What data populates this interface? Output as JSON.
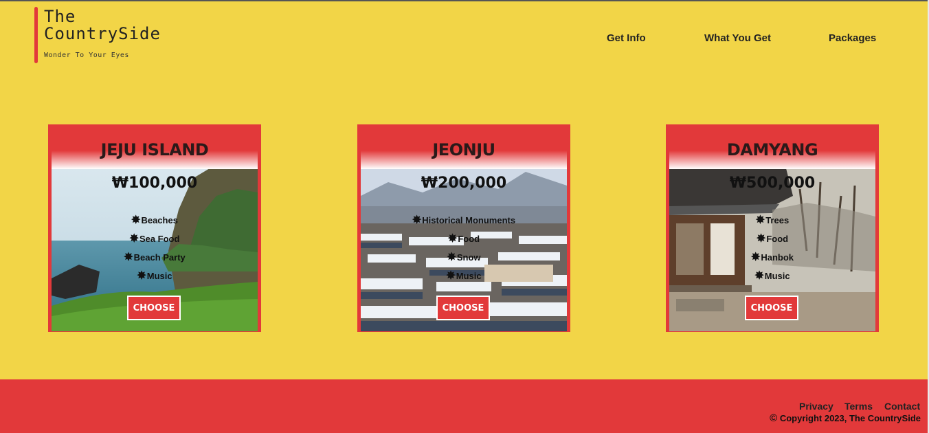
{
  "brand": {
    "title": "The\nCountrySide",
    "tagline": "Wonder To Your Eyes"
  },
  "nav": [
    "Get Info",
    "What You Get",
    "Packages"
  ],
  "cards": [
    {
      "name": "JEJU ISLAND",
      "price": "₩100,000",
      "features": [
        "Beaches",
        "Sea Food",
        "Beach Party",
        "Music"
      ],
      "button": "CHOOSE"
    },
    {
      "name": "JEONJU",
      "price": "₩200,000",
      "features": [
        "Historical Monuments",
        "Food",
        "Snow",
        "Music"
      ],
      "button": "CHOOSE"
    },
    {
      "name": "DAMYANG",
      "price": "₩500,000",
      "features": [
        "Trees",
        "Food",
        "Hanbok",
        "Music"
      ],
      "button": "CHOOSE"
    }
  ],
  "footer": {
    "links": [
      "Privacy",
      "Terms",
      "Contact"
    ],
    "copyright_symbol": "©",
    "copyright": "Copyright 2023, The CountrySide"
  },
  "colors": {
    "background": "#f2d547",
    "accent": "#e2393a",
    "text": "#222222"
  },
  "icons": {
    "feature_bullet": "star-burst-icon",
    "copyright": "copyright-icon"
  }
}
